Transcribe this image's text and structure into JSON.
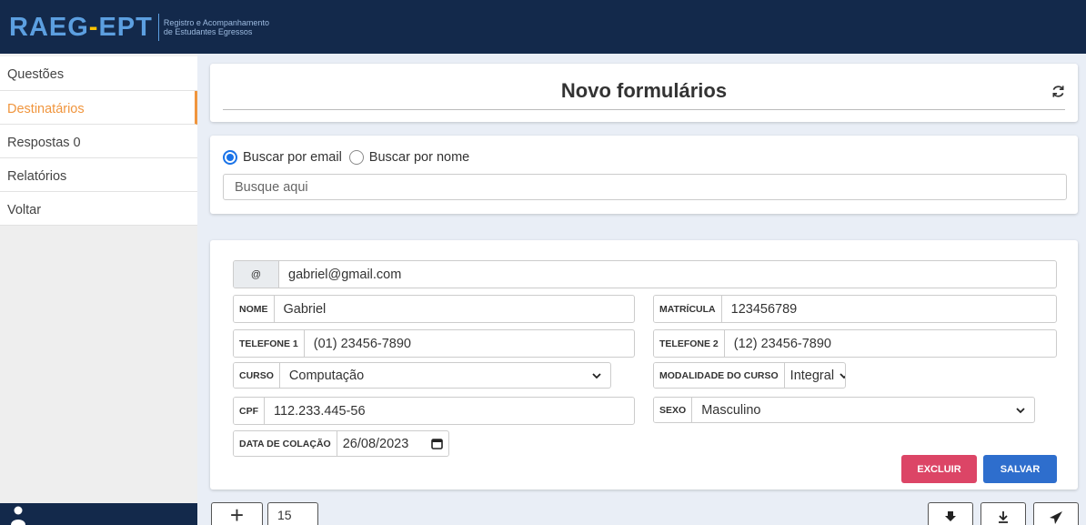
{
  "header": {
    "logo_left": "RAEG",
    "logo_dash": "-",
    "logo_right": "EPT",
    "tagline_line1": "Registro e Acompanhamento",
    "tagline_line2": "de Estudantes Egressos"
  },
  "sidebar": {
    "items": [
      {
        "label": "Questões"
      },
      {
        "label": "Destinatários"
      },
      {
        "label": "Respostas 0"
      },
      {
        "label": "Relatórios"
      },
      {
        "label": "Voltar"
      }
    ],
    "active_index": 1
  },
  "page": {
    "title": "Novo formulários"
  },
  "search": {
    "option_email": "Buscar por email",
    "option_name": "Buscar por nome",
    "selected": "email",
    "placeholder": "Busque aqui"
  },
  "form": {
    "email": {
      "label": "@",
      "value": "gabriel@gmail.com"
    },
    "nome": {
      "label": "NOME",
      "value": "Gabriel"
    },
    "matricula": {
      "label": "MATRÍCULA",
      "value": "123456789"
    },
    "telefone1": {
      "label": "TELEFONE 1",
      "value": "(01) 23456-7890"
    },
    "telefone2": {
      "label": "TELEFONE 2",
      "value": "(12) 23456-7890"
    },
    "curso": {
      "label": "CURSO",
      "value": "Computação"
    },
    "modalidade": {
      "label": "MODALIDADE DO CURSO",
      "value": "Integral"
    },
    "cpf": {
      "label": "CPF",
      "value": "112.233.445-56"
    },
    "sexo": {
      "label": "SEXO",
      "value": "Masculino"
    },
    "data_colacao": {
      "label": "DATA DE COLAÇÃO",
      "value": "26/08/2023"
    }
  },
  "actions": {
    "delete_label": "EXCLUIR",
    "save_label": "SALVAR"
  },
  "footer": {
    "add_label": "+",
    "count": "15"
  },
  "colors": {
    "topbar": "#13294b",
    "accent": "#f0953d",
    "logo_blue": "#5c9fe0",
    "logo_yellow": "#ffc400",
    "delete": "#dc4566",
    "save": "#2e6ecd",
    "radio": "#1a73e8"
  }
}
